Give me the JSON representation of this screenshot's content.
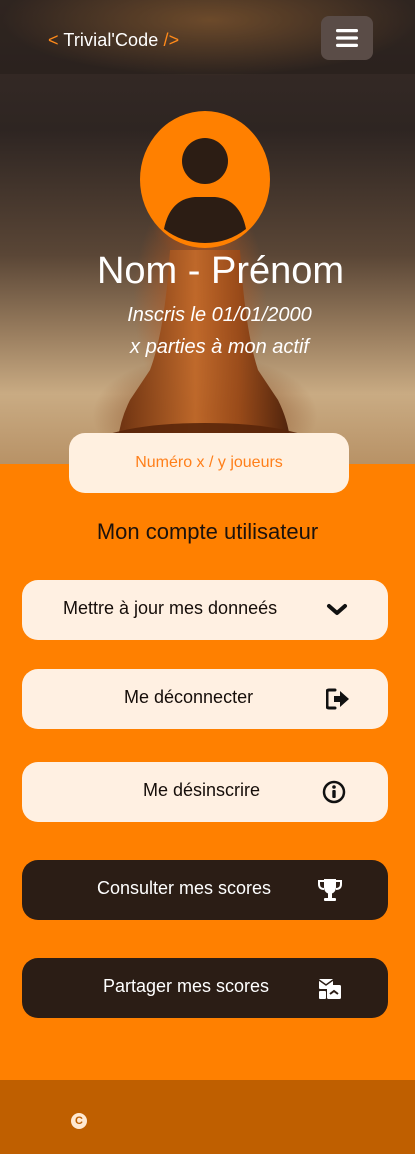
{
  "navbar": {
    "brand_open": "< ",
    "brand_name": "Trivial'Code",
    "brand_close": " />",
    "menu_icon": "hamburger-icon"
  },
  "profile": {
    "avatar_icon": "user-avatar-icon",
    "name": "Nom - Prénom",
    "registered": "Inscris le 01/01/2000",
    "games_played": "x parties à mon actif",
    "rank": "Numéro x / y joueurs"
  },
  "account": {
    "title": "Mon compte utilisateur",
    "buttons": [
      {
        "label": "Mettre à jour mes donneés",
        "icon": "chevron-down-icon"
      },
      {
        "label": "Me déconnecter",
        "icon": "sign-out-icon"
      },
      {
        "label": "Me désinscrire",
        "icon": "info-circle-icon"
      },
      {
        "label": "Consulter mes scores",
        "icon": "trophy-icon"
      },
      {
        "label": "Partager mes scores",
        "icon": "share-envelope-icon"
      }
    ]
  },
  "footer": {
    "copyright_icon": "copyright-icon"
  },
  "colors": {
    "accent": "#ff8000",
    "footer": "#bf5f00",
    "light_button": "#fff0e2",
    "dark_button": "#2b1d15"
  }
}
